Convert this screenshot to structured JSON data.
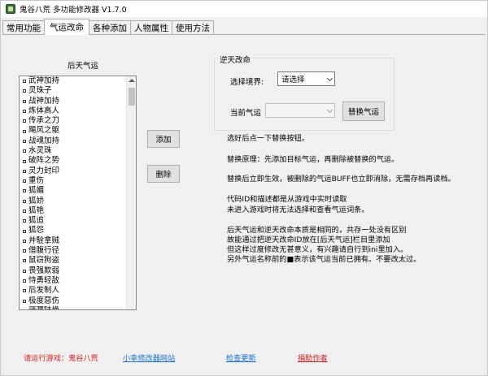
{
  "window": {
    "title": "鬼谷八荒 多功能修改器 V1.7.0"
  },
  "tabs": [
    {
      "label": "常用功能",
      "active": false
    },
    {
      "label": "气运改命",
      "active": true
    },
    {
      "label": "各种添加",
      "active": false
    },
    {
      "label": "人物属性",
      "active": false
    },
    {
      "label": "使用方法",
      "active": false
    }
  ],
  "left": {
    "list_label": "后天气运",
    "items": [
      "武神加持",
      "灵珠子",
      "战神加持",
      "炼体高人",
      "传承之刀",
      "飓风之躯",
      "战魂加持",
      "水灵珠",
      "破阵之势",
      "灵力封印",
      "重伤",
      "狐媚",
      "狐娇",
      "狐艳",
      "狐追",
      "狐怨",
      "并駩拿贼",
      "借腹行径",
      "鼠窃狗盗",
      "畏强欺弱",
      "恃勇轻敌",
      "后发制人",
      "极度惡伤",
      "驿骡陆换"
    ]
  },
  "buttons": {
    "add": "添加",
    "delete": "删除",
    "replace": "替换气运"
  },
  "group": {
    "title": "逆天改命",
    "realm_label": "选择境界:",
    "realm_value": "请选择",
    "current_label": "当前气运",
    "current_value": ""
  },
  "info_lines": [
    "选好后点一下替换按钮。",
    "替换原理：先添加目标气运，再删除被替换的气运。",
    "替换后立即生效，被删除的气运BUFF也立即消除，无需存档再读档。",
    "代码ID和描述都是从游戏中实时读取",
    "未进入游戏时将无法选择和查看气运词条。",
    "后天气运和逆天改命本质是相同的，共存一处没有区别",
    "故能通过把逆天改命ID放在[后天气运]栏目里添加",
    "但这样过度修改无甚意义，有兴趣请自行到ini里加入。",
    "另外气运名称前的■表示该气运当前已拥有。不要改太过。"
  ],
  "bottom": {
    "run_game": "请运行游戏：鬼谷八荒",
    "site": "小幸修改器网站",
    "update": "检查更新",
    "donate": "捐助作者"
  }
}
